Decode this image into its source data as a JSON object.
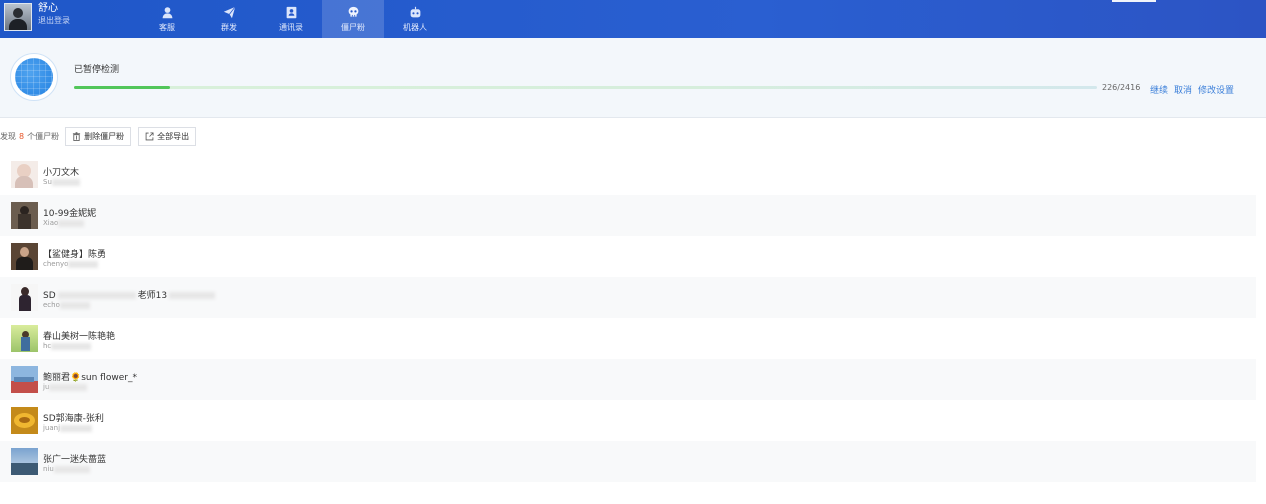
{
  "user": {
    "name": "舒心",
    "logout": "退出登录"
  },
  "nav": [
    {
      "label": "客服",
      "icon": "customer-service-icon"
    },
    {
      "label": "群发",
      "icon": "send-icon"
    },
    {
      "label": "通讯录",
      "icon": "contacts-icon"
    },
    {
      "label": "僵尸粉",
      "icon": "skull-icon",
      "active": true
    },
    {
      "label": "机器人",
      "icon": "robot-icon"
    }
  ],
  "detection": {
    "status": "已暂停检测",
    "progress_current": 226,
    "progress_total": 2416,
    "progress_text": "226/2416",
    "actions": {
      "continue": "继续",
      "cancel": "取消",
      "settings": "修改设置"
    }
  },
  "toolbar": {
    "found_prefix": "发现",
    "found_count": "8",
    "found_suffix": "个僵尸粉",
    "delete_label": "删除僵尸粉",
    "export_label": "全部导出"
  },
  "contacts": [
    {
      "name": "小刀文木",
      "id": "Su"
    },
    {
      "name": "10-99金妮妮",
      "id": "Xiao"
    },
    {
      "name": "【鲨健身】陈勇",
      "id": "chenyo"
    },
    {
      "name": "SD",
      "name_suffix": "老师13",
      "id": "echo"
    },
    {
      "name": "春山美树一陈艳艳",
      "id": "hc"
    },
    {
      "name": "鲍丽君🌻sun flower_*",
      "id": "ju"
    },
    {
      "name": "SD郭海康-张利",
      "id": "juanj"
    },
    {
      "name": "张广一迷失蔷蓝",
      "id": "niu"
    }
  ],
  "colors": {
    "brand": "#2456c9",
    "progress": "#52c65a",
    "link": "#3b7fd9",
    "count_highlight": "#e8572a"
  }
}
